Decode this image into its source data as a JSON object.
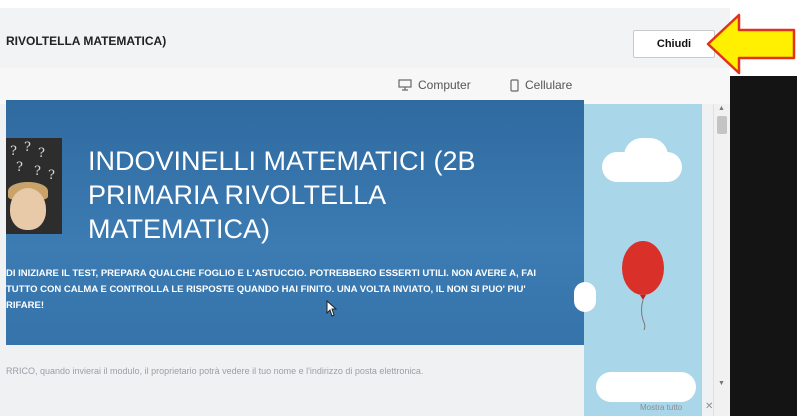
{
  "window": {
    "title": "RIVOLTELLA MATEMATICA)",
    "close_label": "Chiudi"
  },
  "device_toggle": {
    "computer_label": "Computer",
    "mobile_label": "Cellulare"
  },
  "form": {
    "title": "INDOVINELLI MATEMATICI (2B PRIMARIA RIVOLTELLA MATEMATICA)",
    "description": "DI INIZIARE IL TEST, PREPARA QUALCHE FOGLIO E L'ASTUCCIO. POTREBBERO ESSERTI UTILI. NON AVERE A, FAI TUTTO CON CALMA E CONTROLLA LE RISPOSTE QUANDO HAI FINITO. UNA VOLTA INVIATO, IL NON SI PUO' PIU' RIFARE!",
    "privacy_note": "RRICO, quando invierai il modulo, il proprietario potrà vedere il tuo nome e l'indirizzo di posta elettronica."
  },
  "footer": {
    "show_all_label": "Mostra tutto",
    "close_symbol": "✕"
  },
  "colors": {
    "banner": "#3573aa",
    "side_panel": "#a9d6e9",
    "arrow": "#ffef00",
    "balloon": "#d9302a"
  },
  "icons": [
    "computer-icon",
    "mobile-phone-icon",
    "arrow-pointer-icon"
  ]
}
